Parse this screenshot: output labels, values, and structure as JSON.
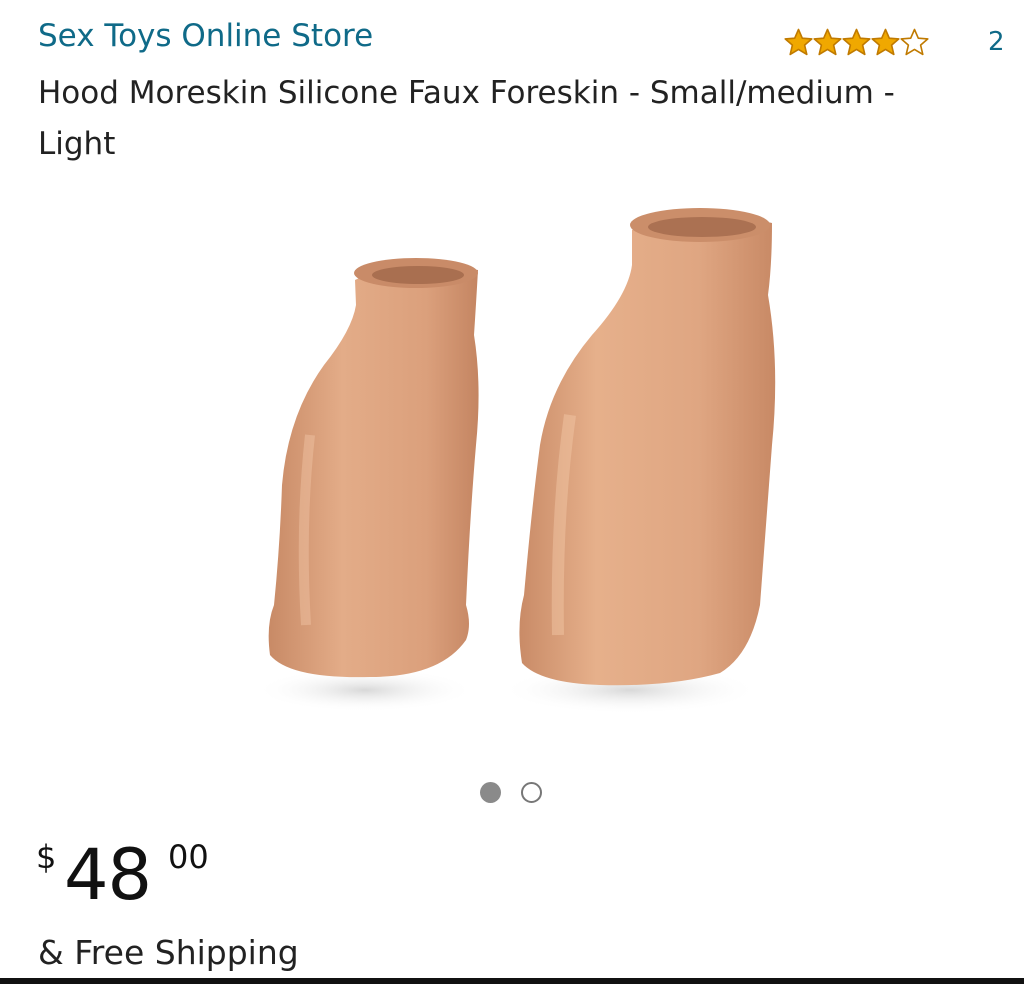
{
  "store": {
    "name": "Sex Toys Online Store"
  },
  "rating": {
    "stars": 4,
    "max": 5,
    "review_count": "2",
    "star_color": "#f0a800"
  },
  "product": {
    "title": "Hood Moreskin Silicone Faux Foreskin - Small/medium - Light",
    "image_icon": "product-photo",
    "carousel": {
      "count": 2,
      "active_index": 0
    }
  },
  "price": {
    "currency": "$",
    "whole": "48",
    "fraction": "00"
  },
  "shipping": {
    "text": "& Free Shipping"
  },
  "colors": {
    "link": "#0f6a88",
    "text": "#222222",
    "skin": "#d9a07e"
  }
}
